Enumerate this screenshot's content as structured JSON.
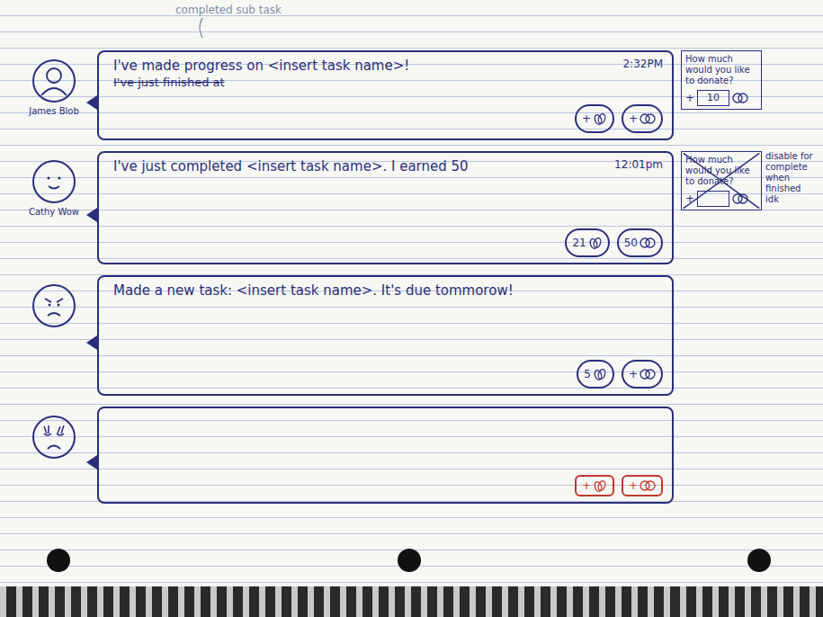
{
  "annotation": {
    "text": "completed sub task"
  },
  "posts": [
    {
      "author": "James Blob",
      "kind": "person",
      "text": "I've made progress on <insert task name>!",
      "struck": "I've just finished at",
      "time": "2:32PM",
      "claps": "+",
      "coins": "+",
      "color": "#2b2f7a",
      "donate": {
        "title": "How much would you like to donate?",
        "plus": "+",
        "amount": "10",
        "crossed": false,
        "note": ""
      }
    },
    {
      "author": "Cathy Wow",
      "kind": "smile",
      "text": "I've just completed <insert task name>. I earned 50",
      "time": "12:01pm",
      "claps": "21",
      "coins": "50",
      "color": "#2b2f7a",
      "donate": {
        "title": "How much would you like to donate?",
        "plus": "+",
        "amount": "",
        "crossed": true,
        "note": "disable for complete when finished idk"
      }
    },
    {
      "author": "",
      "kind": "angry",
      "text": "Made a new task: <insert task name>. It's due tommorow!",
      "time": "",
      "claps": "5",
      "coins": "+",
      "color": "#2b2f7a"
    },
    {
      "author": "",
      "kind": "crying",
      "text": "",
      "time": "",
      "claps": "+",
      "coins": "+",
      "color": "#c0392b"
    }
  ]
}
